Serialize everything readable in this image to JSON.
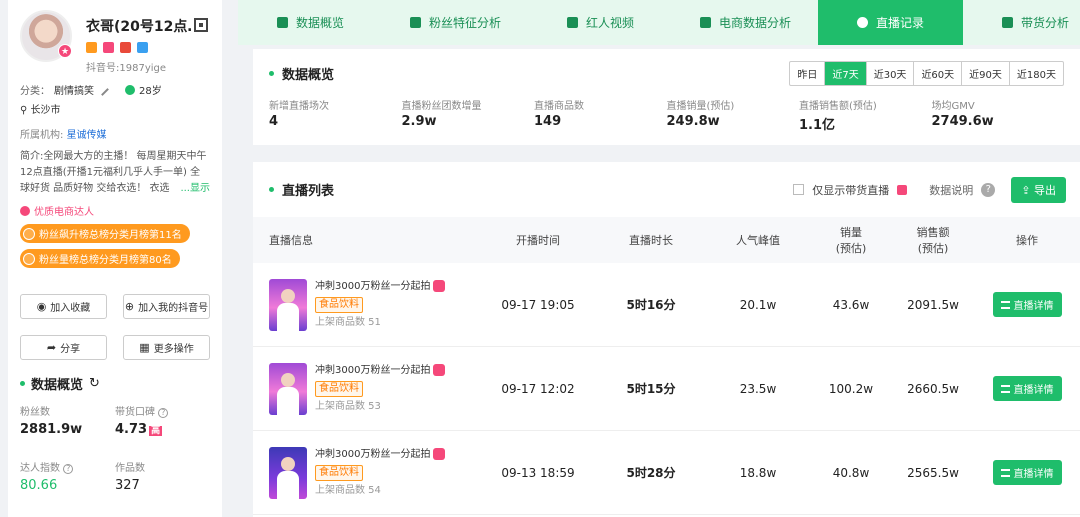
{
  "profile": {
    "name": "衣哥(20号12点…",
    "douyin_id": "抖音号:1987yige",
    "category_label": "分类：",
    "category": "剧情搞笑",
    "age": "28岁",
    "location": "长沙市",
    "org_label": "所属机构:",
    "org": "星诚传媒",
    "intro": "简介:全网最大方的主播！ 每周星期天中午12点直播(开播1元福利几乎人手一单) 全球好货 品质好物 交给衣选！ 衣选",
    "intro_more": "...显示",
    "quality_tag": "优质电商达人",
    "rank1": "粉丝飙升榜总榜分类月榜第11名",
    "rank2": "粉丝量榜总榜分类月榜第80名",
    "colors": {
      "accent": "#1fbd6b",
      "pink": "#f5487a",
      "orange": "#ff9a1f"
    }
  },
  "actions": {
    "favorite": "加入收藏",
    "add_mine": "加入我的抖音号",
    "share": "分享",
    "more": "更多操作"
  },
  "side_overview": {
    "title": "数据概览",
    "fans_label": "粉丝数",
    "fans": "2881.9w",
    "reputation_label": "带货口碑",
    "reputation": "4.73",
    "reputation_badge": "高",
    "dadou_label": "达人指数",
    "dadou": "80.66",
    "works_label": "作品数",
    "works": "327"
  },
  "tabs": [
    "数据概览",
    "粉丝特征分析",
    "红人视频",
    "电商数据分析",
    "直播记录",
    "带货分析"
  ],
  "overview": {
    "title": "数据概览",
    "ranges": [
      "昨日",
      "近7天",
      "近30天",
      "近60天",
      "近90天",
      "近180天"
    ],
    "stats": [
      {
        "label": "新增直播场次",
        "value": "4"
      },
      {
        "label": "直播粉丝团数增量",
        "value": "2.9w"
      },
      {
        "label": "直播商品数",
        "value": "149"
      },
      {
        "label": "直播销量(预估)",
        "value": "249.8w"
      },
      {
        "label": "直播销售额(预估)",
        "value": "1.1亿"
      },
      {
        "label": "场均GMV",
        "value": "2749.6w"
      }
    ]
  },
  "livelist": {
    "title": "直播列表",
    "only_goods": "仅显示带货直播",
    "data_note": "数据说明",
    "export": "导出",
    "headers": {
      "info": "直播信息",
      "start": "开播时间",
      "duration": "直播时长",
      "peak": "人气峰值",
      "sales1": "销量",
      "sales2": "(预估)",
      "amount1": "销售额",
      "amount2": "(预估)",
      "op": "操作"
    },
    "rows": [
      {
        "title": "冲刺3000万粉丝一分起拍",
        "category": "食品饮料",
        "goods": "上架商品数 51",
        "start": "09-17 19:05",
        "duration": "5时16分",
        "peak": "20.1w",
        "sales": "43.6w",
        "amount": "2091.5w",
        "detail": "直播详情"
      },
      {
        "title": "冲刺3000万粉丝一分起拍",
        "category": "食品饮料",
        "goods": "上架商品数 53",
        "start": "09-17 12:02",
        "duration": "5时15分",
        "peak": "23.5w",
        "sales": "100.2w",
        "amount": "2660.5w",
        "detail": "直播详情"
      },
      {
        "title": "冲刺3000万粉丝一分起拍",
        "category": "食品饮料",
        "goods": "上架商品数 54",
        "start": "09-13 18:59",
        "duration": "5时28分",
        "peak": "18.8w",
        "sales": "40.8w",
        "amount": "2565.5w",
        "detail": "直播详情"
      }
    ]
  }
}
